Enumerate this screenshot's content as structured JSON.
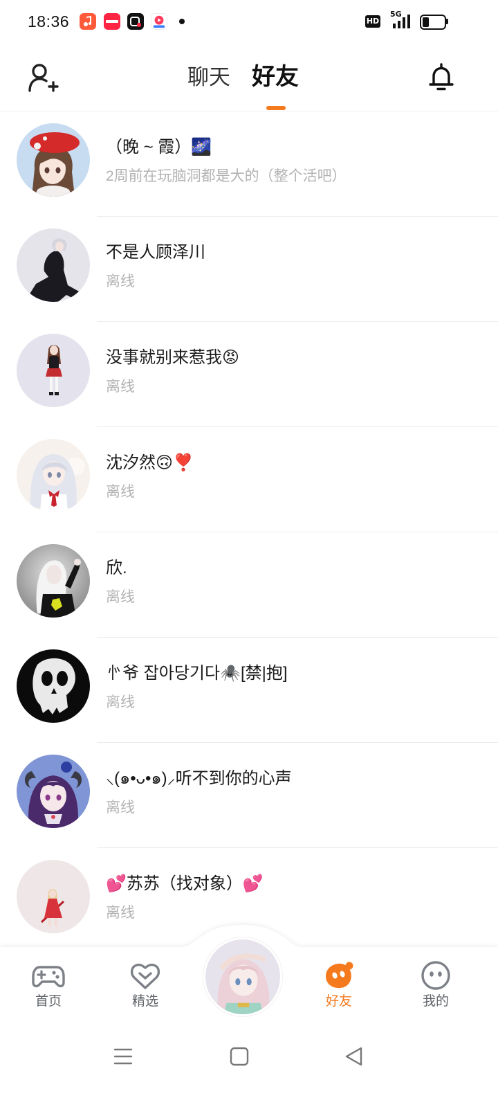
{
  "status_bar": {
    "time": "18:36",
    "network_badge": "HD",
    "network_type": "5G",
    "battery_level": 0.3,
    "notification_icons": [
      "music-app-icon",
      "xiaohongshu-app-icon",
      "video-app-icon",
      "media-app-icon"
    ]
  },
  "header": {
    "left_icon": "add-friend-icon",
    "right_icon": "bell-icon",
    "tabs": [
      {
        "label": "聊天",
        "active": false
      },
      {
        "label": "好友",
        "active": true
      }
    ]
  },
  "friends": [
    {
      "name": "（晚 ~ 霞）🌌",
      "status": "2周前在玩脑洞都是大的（整个活吧）"
    },
    {
      "name": "不是人顾泽川",
      "status": "离线"
    },
    {
      "name": "没事就别来惹我😡",
      "status": "离线"
    },
    {
      "name": "沈汐然🙃❣️",
      "status": "离线"
    },
    {
      "name": "欣.",
      "status": "离线"
    },
    {
      "name": "㣺爷 잡아당기다🕷️[禁|抱]",
      "status": "离线"
    },
    {
      "name": "⸜(๑•ᴗ•๑)⸝听不到你的心声",
      "status": "离线"
    },
    {
      "name": "💕苏苏（找对象）💕",
      "status": "离线"
    }
  ],
  "bottom_nav": {
    "items": [
      {
        "label": "首页",
        "icon": "gamepad-icon",
        "active": false
      },
      {
        "label": "精选",
        "icon": "heart-icon",
        "active": false
      },
      {
        "label": "好友",
        "icon": "friends-blob-icon",
        "active": true
      },
      {
        "label": "我的",
        "icon": "face-icon",
        "active": false
      }
    ],
    "center_icon": "profile-avatar"
  },
  "system_nav": {
    "icons": [
      "menu-icon",
      "home-square-icon",
      "back-triangle-icon"
    ]
  },
  "colors": {
    "accent": "#F57A1E",
    "text_primary": "#1A1A1A",
    "text_secondary": "#B3B3B3",
    "icon_gray": "#7D8187",
    "background": "#FFFFFF"
  }
}
